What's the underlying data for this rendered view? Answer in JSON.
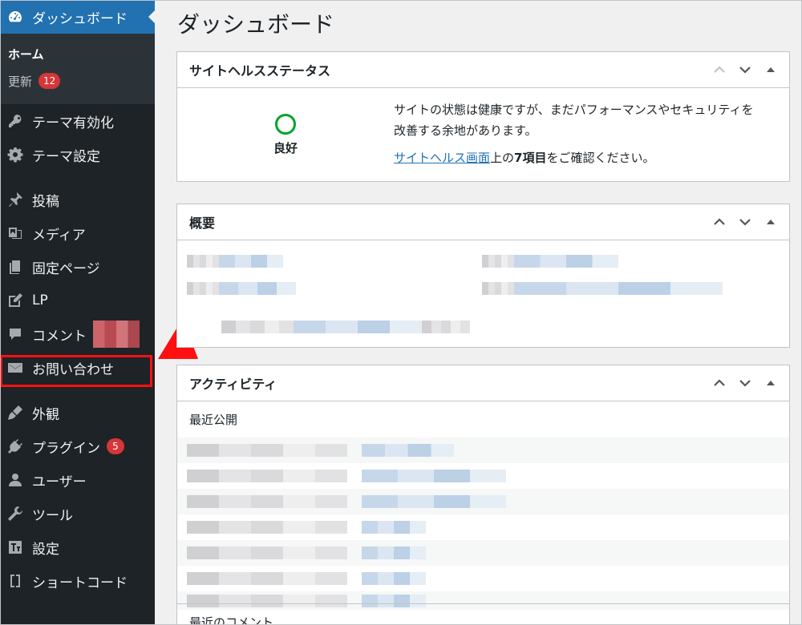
{
  "sidebar": {
    "dashboard": "ダッシュボード",
    "sub_home": "ホーム",
    "sub_updates": "更新",
    "updates_badge": "12",
    "items": [
      {
        "label": "テーマ有効化",
        "icon": "key-icon"
      },
      {
        "label": "テーマ設定",
        "icon": "gear-icon"
      },
      {
        "label": "投稿",
        "icon": "pin-icon"
      },
      {
        "label": "メディア",
        "icon": "media-icon"
      },
      {
        "label": "固定ページ",
        "icon": "page-icon"
      },
      {
        "label": "LP",
        "icon": "edit-icon"
      },
      {
        "label": "コメント",
        "icon": "comment-icon"
      },
      {
        "label": "お問い合わせ",
        "icon": "mail-icon"
      },
      {
        "label": "外観",
        "icon": "brush-icon"
      },
      {
        "label": "プラグイン",
        "icon": "plugin-icon"
      },
      {
        "label": "ユーザー",
        "icon": "user-icon"
      },
      {
        "label": "ツール",
        "icon": "wrench-icon"
      },
      {
        "label": "設定",
        "icon": "settings-icon"
      },
      {
        "label": "ショートコード",
        "icon": "brackets-icon"
      }
    ],
    "plugins_badge": "5"
  },
  "main": {
    "title": "ダッシュボード",
    "health": {
      "title": "サイトヘルスステータス",
      "status": "良好",
      "text": "サイトの状態は健康ですが、まだパフォーマンスやセキュリティを改善する余地があります。",
      "link": "サイトヘルス画面",
      "text2_pre": "上の",
      "text2_bold": "7項目",
      "text2_post": "をご確認ください。"
    },
    "overview": {
      "title": "概要"
    },
    "activity": {
      "title": "アクティビティ",
      "recent_published": "最近公開",
      "recent_comments": "最近のコメント"
    }
  },
  "colors": {
    "sidebar_bg": "#1d2327",
    "accent": "#2271b1",
    "badge": "#d63638",
    "health_good": "#00a32a",
    "highlight": "#ff1010"
  }
}
